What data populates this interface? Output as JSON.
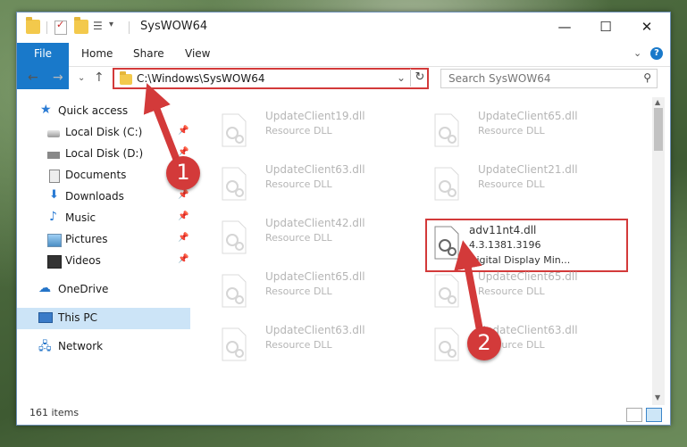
{
  "window": {
    "title": "SysWOW64"
  },
  "ribbon": {
    "tabs": [
      "File",
      "Home",
      "Share",
      "View"
    ]
  },
  "address": {
    "path": "C:\\Windows\\SysWOW64"
  },
  "search": {
    "placeholder": "Search SysWOW64"
  },
  "sidebar": {
    "items": [
      {
        "label": "Quick access",
        "icon": "star-icon"
      },
      {
        "label": "Local Disk (C:)",
        "icon": "drive-icon",
        "pinned": true
      },
      {
        "label": "Local Disk (D:)",
        "icon": "drive-icon",
        "pinned": true
      },
      {
        "label": "Documents",
        "icon": "documents-icon",
        "pinned": true
      },
      {
        "label": "Downloads",
        "icon": "downloads-icon",
        "pinned": true
      },
      {
        "label": "Music",
        "icon": "music-icon",
        "pinned": true
      },
      {
        "label": "Pictures",
        "icon": "pictures-icon",
        "pinned": true
      },
      {
        "label": "Videos",
        "icon": "videos-icon",
        "pinned": true
      },
      {
        "label": "OneDrive",
        "icon": "onedrive-icon"
      },
      {
        "label": "This PC",
        "icon": "this-pc-icon",
        "selected": true
      },
      {
        "label": "Network",
        "icon": "network-icon"
      }
    ]
  },
  "files": [
    {
      "name": "UpdateClient19.dll",
      "desc": "Resource DLL"
    },
    {
      "name": "UpdateClient65.dll",
      "desc": "Resource DLL"
    },
    {
      "name": "UpdateClient63.dll",
      "desc": "Resource DLL"
    },
    {
      "name": "UpdateClient21.dll",
      "desc": "Resource DLL"
    },
    {
      "name": "UpdateClient42.dll",
      "desc": "Resource DLL"
    },
    {
      "name": "adv11nt4.dll",
      "version": "4.3.1381.3196",
      "desc": "Digital Display Min..."
    },
    {
      "name": "UpdateClient65.dll",
      "desc": "Resource DLL"
    },
    {
      "name": "UpdateClient65.dll",
      "desc": "Resource DLL"
    },
    {
      "name": "UpdateClient63.dll",
      "desc": "Resource DLL"
    },
    {
      "name": "UpdateClient63.dll",
      "desc": "Resource DLL"
    }
  ],
  "status": {
    "count": "161 items"
  },
  "annotations": {
    "step1": "1",
    "step2": "2",
    "color": "#d33a3a"
  }
}
